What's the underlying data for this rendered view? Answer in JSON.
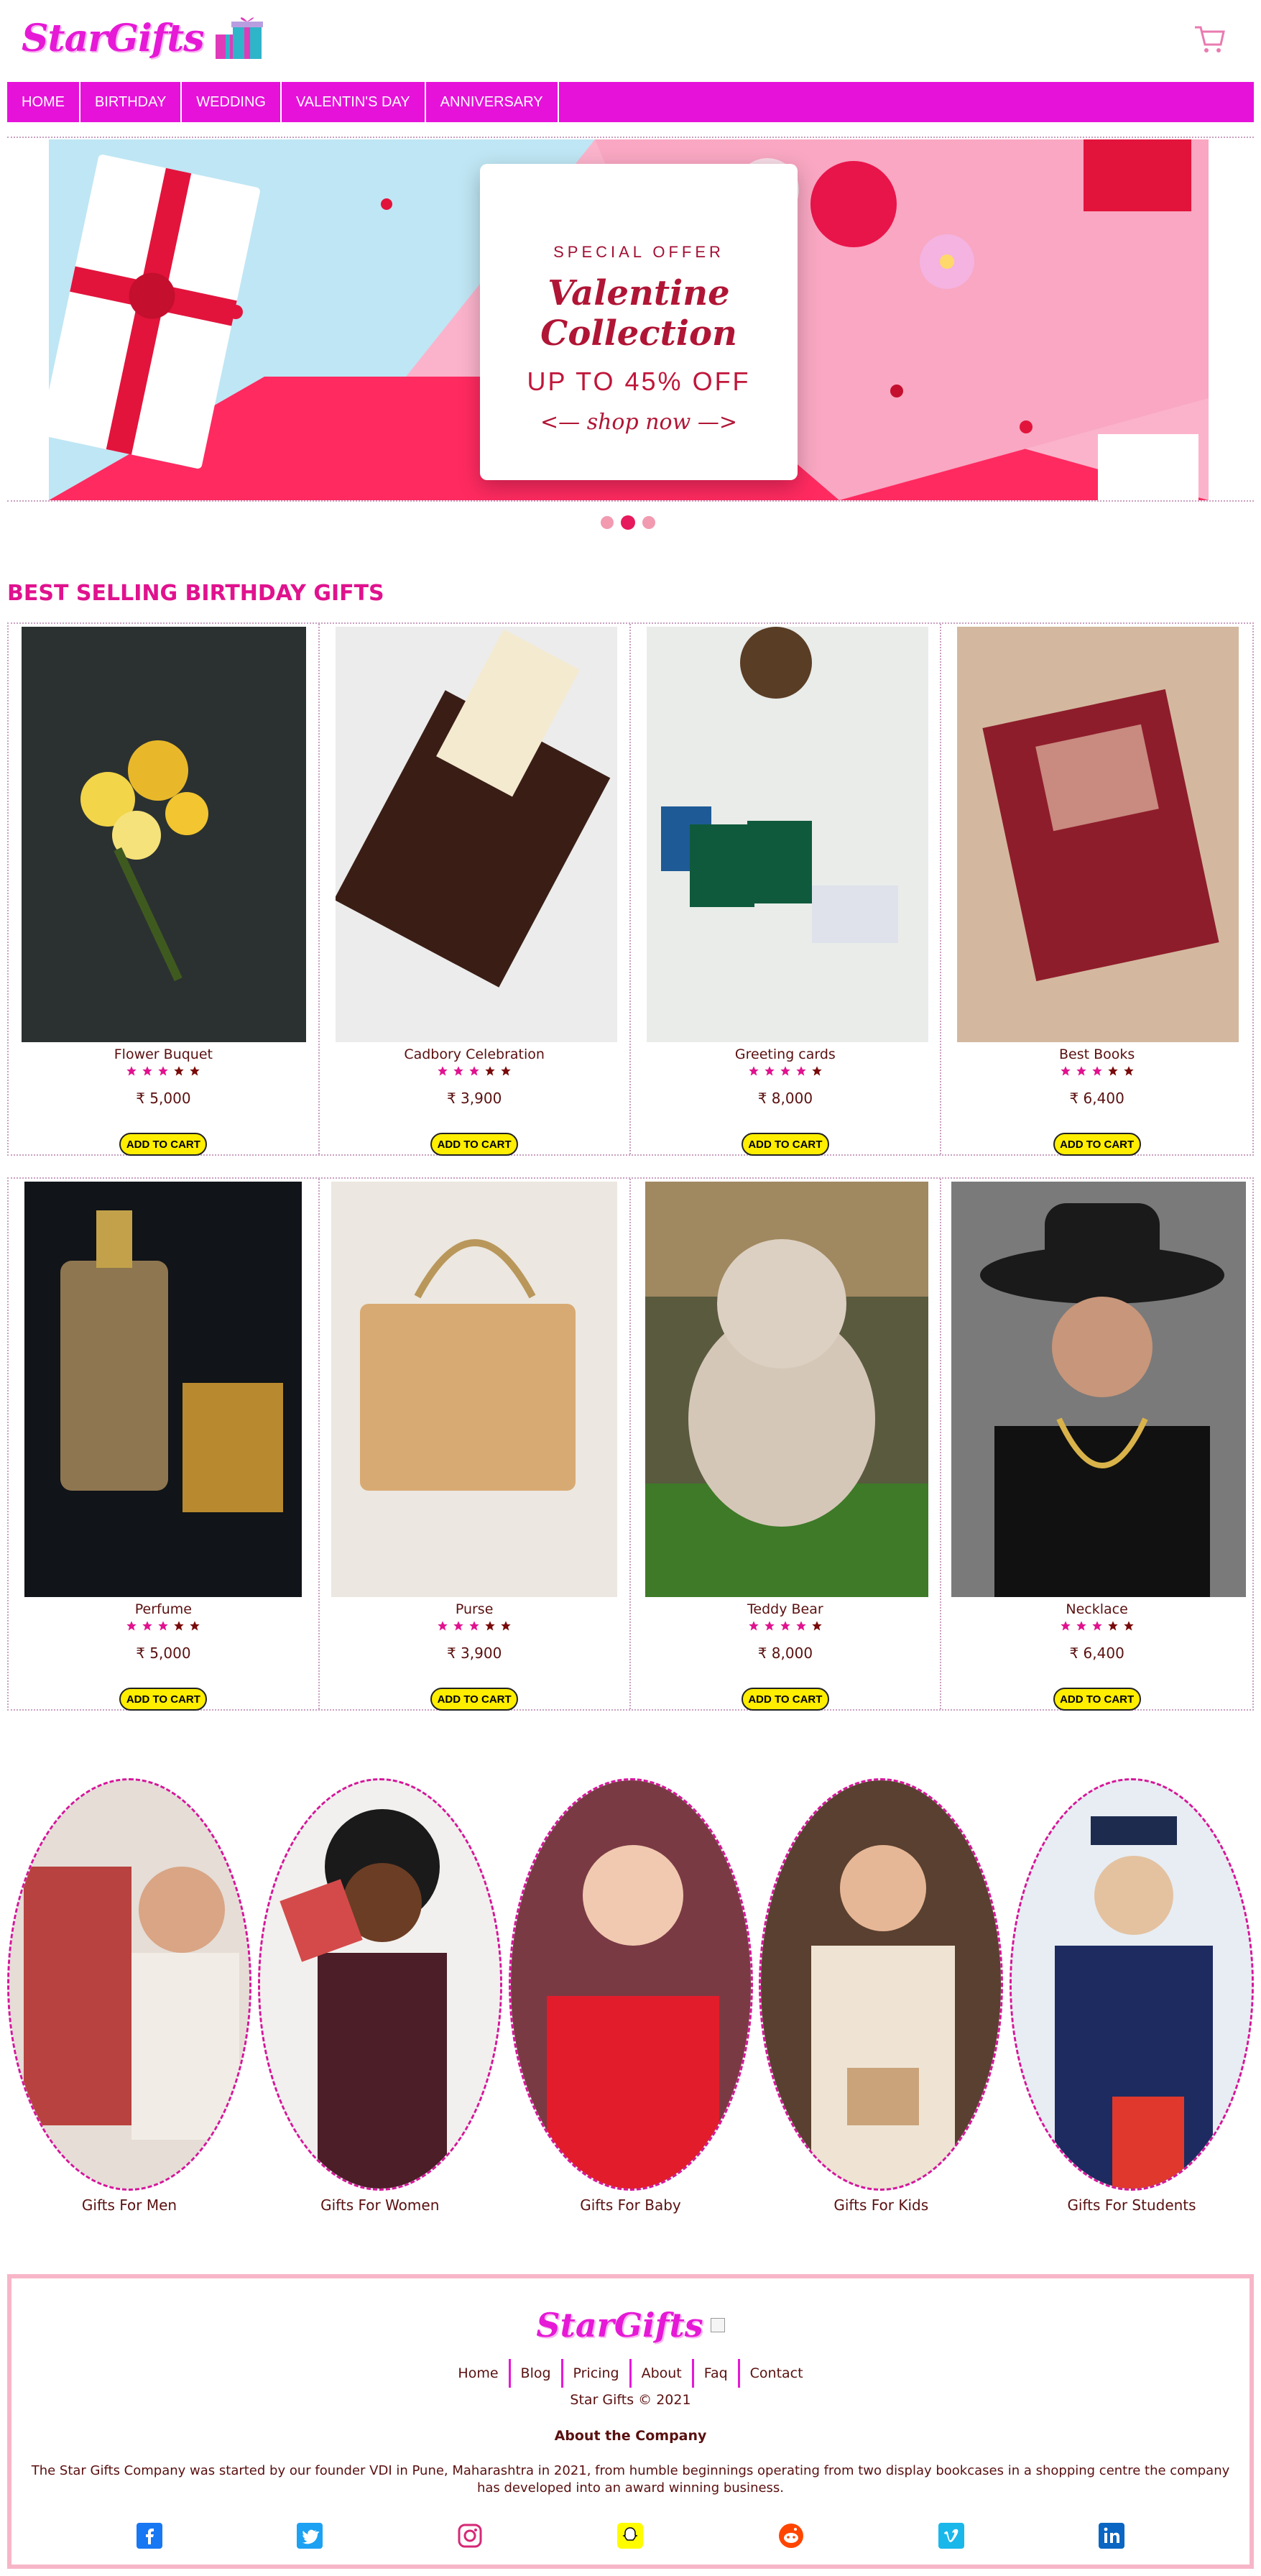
{
  "header": {
    "logo": "StarGifts",
    "cart_icon": "shopping-cart-icon"
  },
  "nav": {
    "items": [
      {
        "label": "HOME"
      },
      {
        "label": "BIRTHDAY"
      },
      {
        "label": "WEDDING"
      },
      {
        "label": "VALENTIN'S DAY"
      },
      {
        "label": "ANNIVERSARY"
      }
    ]
  },
  "hero": {
    "kicker": "SPECIAL OFFER",
    "title": "Valentine Collection",
    "subtitle": "UP TO 45% OFF",
    "cta": "shop now",
    "slides": 3,
    "active_slide": 2
  },
  "best_selling": {
    "title": "BEST SELLING BIRTHDAY GIFTS",
    "button_label": "ADD TO CART",
    "products": [
      {
        "name": "Flower Buquet",
        "price": "₹ 5,000",
        "rating": 3
      },
      {
        "name": "Cadbory Celebration",
        "price": "₹ 3,900",
        "rating": 3
      },
      {
        "name": "Greeting cards",
        "price": "₹ 8,000",
        "rating": 4
      },
      {
        "name": "Best Books",
        "price": "₹ 6,400",
        "rating": 3
      },
      {
        "name": "Perfume",
        "price": "₹ 5,000",
        "rating": 3
      },
      {
        "name": "Purse",
        "price": "₹ 3,900",
        "rating": 3
      },
      {
        "name": "Teddy Bear",
        "price": "₹ 8,000",
        "rating": 4
      },
      {
        "name": "Necklace",
        "price": "₹ 6,400",
        "rating": 3
      }
    ]
  },
  "categories": [
    {
      "label": "Gifts For Men"
    },
    {
      "label": "Gifts For Women"
    },
    {
      "label": "Gifts For Baby"
    },
    {
      "label": "Gifts For Kids"
    },
    {
      "label": "Gifts For Students"
    }
  ],
  "footer": {
    "logo": "StarGifts",
    "links": [
      "Home",
      "Blog",
      "Pricing",
      "About",
      "Faq",
      "Contact"
    ],
    "copyright": "Star Gifts © 2021",
    "about_heading": "About the Company",
    "about_text": "The Star Gifts Company was started by our founder VDI in Pune, Maharashtra in 2021, from humble beginnings operating from two display bookcases in a shopping centre the company has developed into an award winning business.",
    "socials": [
      "facebook-icon",
      "twitter-icon",
      "instagram-icon",
      "snapchat-icon",
      "reddit-icon",
      "vimeo-icon",
      "linkedin-icon"
    ]
  },
  "colors": {
    "brand": "#e619d6",
    "nav_bg": "#e612da",
    "section_title": "#e0128e",
    "star_filled": "#e0128e",
    "star_empty": "#7a0a0a",
    "button": "#ffee00"
  }
}
